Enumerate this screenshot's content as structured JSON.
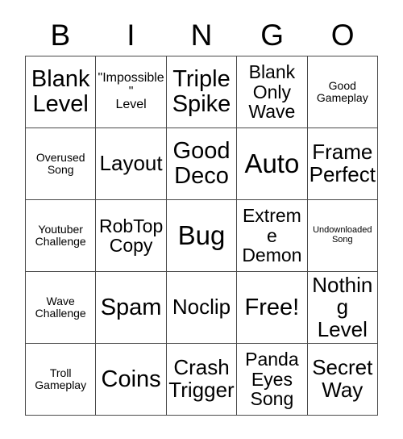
{
  "card": {
    "title": "BINGO",
    "header_letters": [
      "B",
      "I",
      "N",
      "G",
      "O"
    ],
    "border_color": "#4a4a4a",
    "text_color": "#000000",
    "background_color": "#ffffff",
    "columns": 5,
    "rows": 5,
    "free_space_label": "Free!",
    "cells": [
      {
        "text": "Blank\nLevel",
        "size": "xl"
      },
      {
        "text": "\"Impossible\"\nLevel",
        "size": "sm"
      },
      {
        "text": "Triple\nSpike",
        "size": "xl"
      },
      {
        "text": "Blank\nOnly\nWave",
        "size": "md"
      },
      {
        "text": "Good\nGameplay",
        "size": "xs"
      },
      {
        "text": "Overused\nSong",
        "size": "xs"
      },
      {
        "text": "Layout",
        "size": "lg"
      },
      {
        "text": "Good\nDeco",
        "size": "xl"
      },
      {
        "text": "Auto",
        "size": "xxl"
      },
      {
        "text": "Frame\nPerfect",
        "size": "lg"
      },
      {
        "text": "Youtuber\nChallenge",
        "size": "xs"
      },
      {
        "text": "RobTop\nCopy",
        "size": "md"
      },
      {
        "text": "Bug",
        "size": "xxl"
      },
      {
        "text": "Extreme\nDemon",
        "size": "md"
      },
      {
        "text": "Undownloaded\nSong",
        "size": "xxs"
      },
      {
        "text": "Wave\nChallenge",
        "size": "xs"
      },
      {
        "text": "Spam",
        "size": "xl"
      },
      {
        "text": "Noclip",
        "size": "lg"
      },
      {
        "text": "Free!",
        "size": "xl"
      },
      {
        "text": "Nothing\nLevel",
        "size": "lg"
      },
      {
        "text": "Troll\nGameplay",
        "size": "xs"
      },
      {
        "text": "Coins",
        "size": "xl"
      },
      {
        "text": "Crash\nTrigger",
        "size": "lg"
      },
      {
        "text": "Panda\nEyes\nSong",
        "size": "md"
      },
      {
        "text": "Secret\nWay",
        "size": "lg"
      }
    ]
  }
}
